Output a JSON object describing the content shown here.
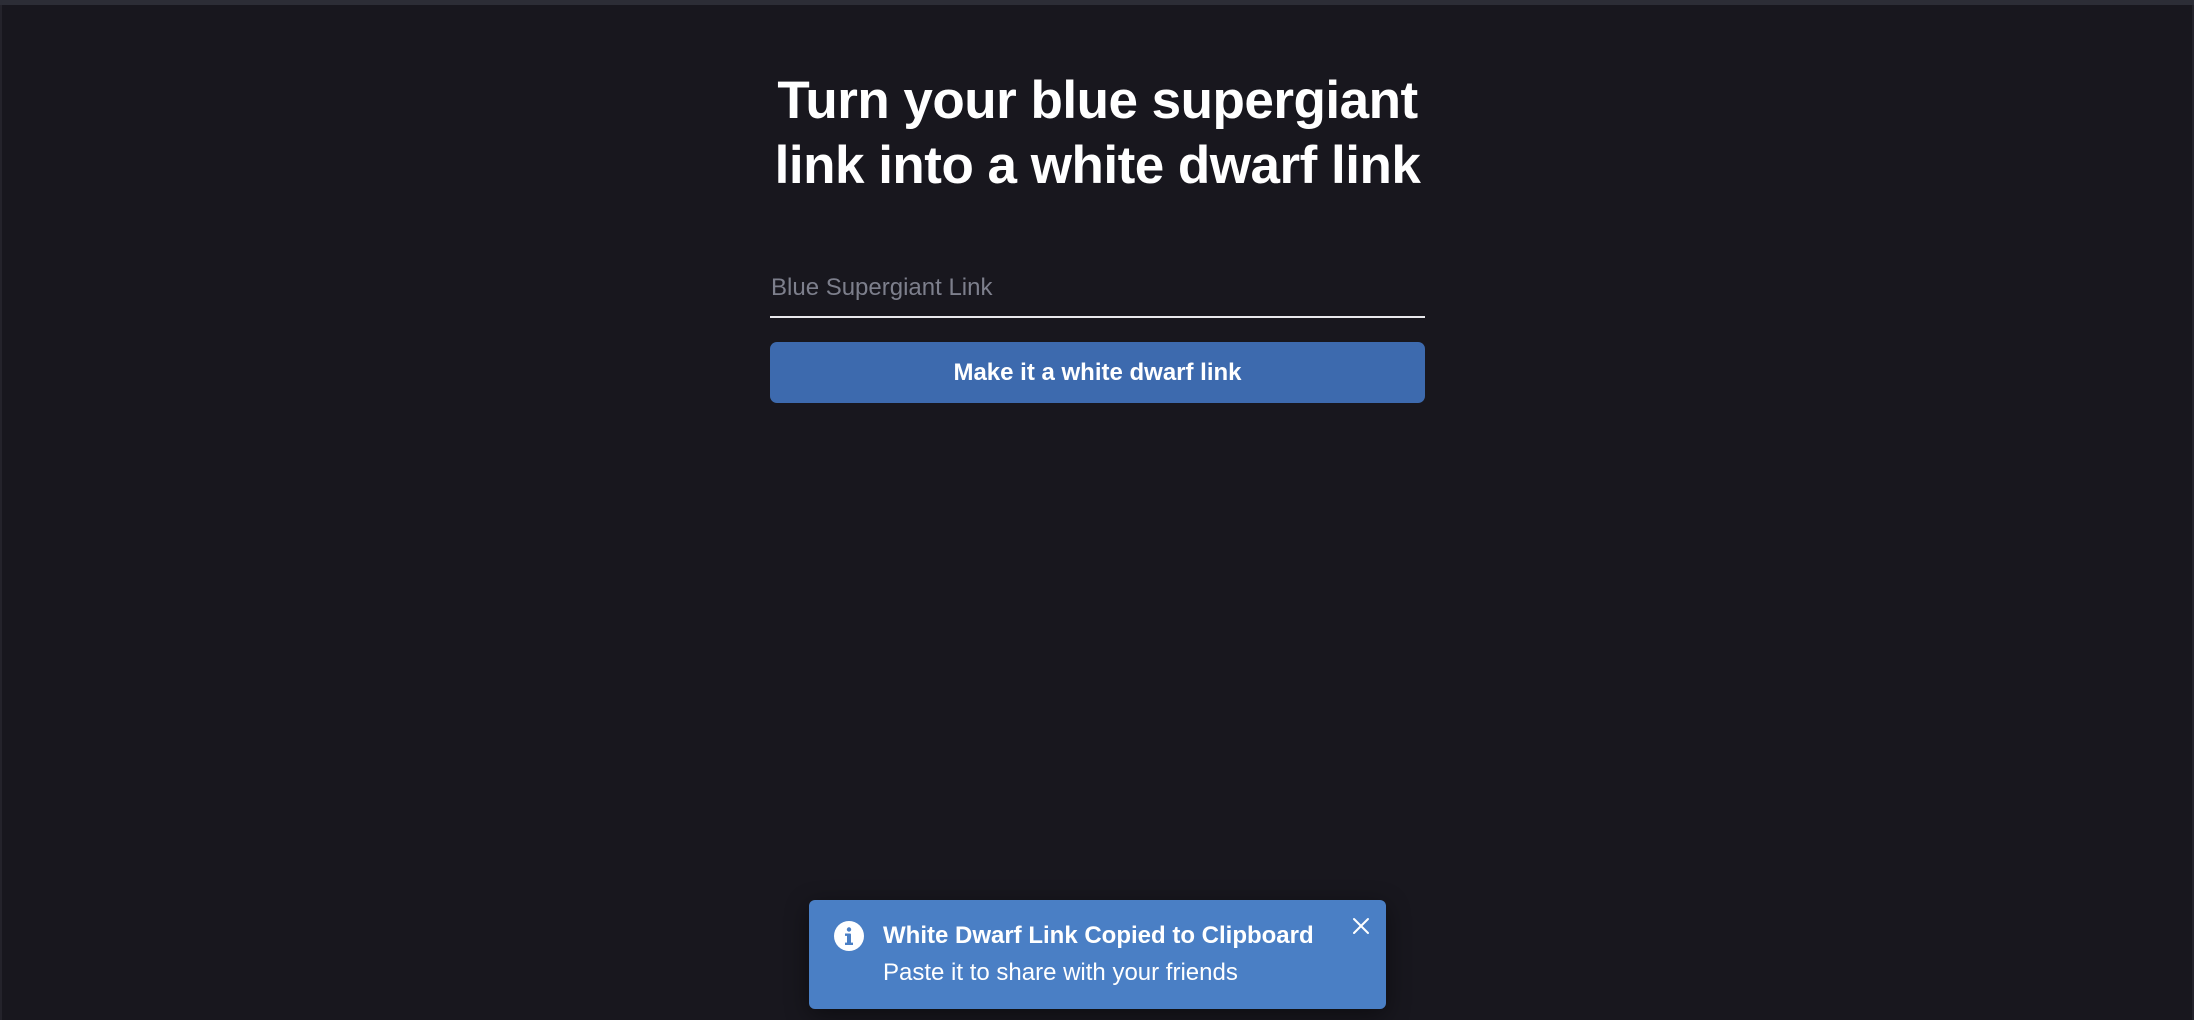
{
  "page": {
    "title_line1": "Turn your blue supergiant",
    "title_line2": "link into a white dwarf link"
  },
  "form": {
    "input_placeholder": "Blue Supergiant Link",
    "input_value": "",
    "submit_label": "Make it a white dwarf link"
  },
  "toast": {
    "icon": "info-icon",
    "title": "White Dwarf Link Copied to Clipboard",
    "description": "Paste it to share with your friends",
    "close_icon": "close-icon"
  },
  "colors": {
    "background": "#18171e",
    "button": "#3d6aae",
    "toast": "#4a7fc5",
    "text": "#ffffff",
    "placeholder": "#7d7f8c"
  }
}
